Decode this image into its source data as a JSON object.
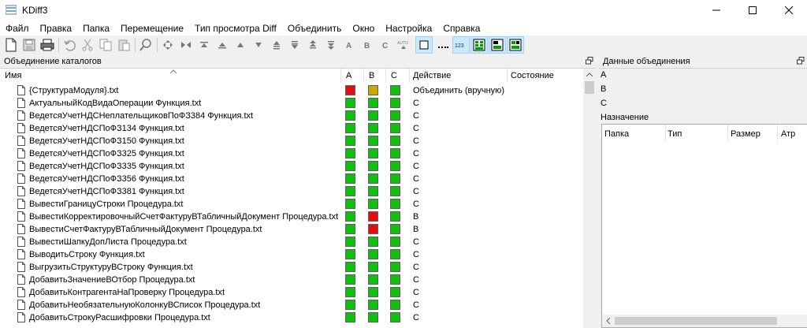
{
  "window": {
    "title": "KDiff3"
  },
  "menu": [
    "Файл",
    "Правка",
    "Папка",
    "Перемещение",
    "Тип просмотра Diff",
    "Объединить",
    "Окно",
    "Настройка",
    "Справка"
  ],
  "left_panel": {
    "title": "Объединение каталогов",
    "columns": {
      "name": "Имя",
      "a": "A",
      "b": "B",
      "c": "C",
      "action": "Действие",
      "state": "Состояние"
    },
    "rows": [
      {
        "name": "{СтруктураМодуля}.txt",
        "a": "red",
        "b": "yellow",
        "c": "green",
        "action": "Объединить (вручную)"
      },
      {
        "name": "АктуальныйКодВидаОперации Функция.txt",
        "a": "green",
        "b": "green",
        "c": "green",
        "action": "C"
      },
      {
        "name": "ВедетсяУчетНДСНеплательщиковПоФЗ384 Функция.txt",
        "a": "green",
        "b": "green",
        "c": "green",
        "action": "C"
      },
      {
        "name": "ВедетсяУчетНДСПоФЗ134 Функция.txt",
        "a": "green",
        "b": "green",
        "c": "green",
        "action": "C"
      },
      {
        "name": "ВедетсяУчетНДСПоФЗ150 Функция.txt",
        "a": "green",
        "b": "green",
        "c": "green",
        "action": "C"
      },
      {
        "name": "ВедетсяУчетНДСПоФЗ325 Функция.txt",
        "a": "green",
        "b": "green",
        "c": "green",
        "action": "C"
      },
      {
        "name": "ВедетсяУчетНДСПоФЗ335 Функция.txt",
        "a": "green",
        "b": "green",
        "c": "green",
        "action": "C"
      },
      {
        "name": "ВедетсяУчетНДСПоФЗ356 Функция.txt",
        "a": "green",
        "b": "green",
        "c": "green",
        "action": "C"
      },
      {
        "name": "ВедетсяУчетНДСПоФЗ381 Функция.txt",
        "a": "green",
        "b": "green",
        "c": "green",
        "action": "C"
      },
      {
        "name": "ВывестиГраницуСтроки Процедура.txt",
        "a": "green",
        "b": "green",
        "c": "green",
        "action": "C"
      },
      {
        "name": "ВывестиКорректировочныйСчетФактуруВТабличныйДокумент Процедура.txt",
        "a": "green",
        "b": "red",
        "c": "green",
        "action": "B"
      },
      {
        "name": "ВывестиСчетФактуруВТабличныйДокумент Процедура.txt",
        "a": "green",
        "b": "red",
        "c": "green",
        "action": "B"
      },
      {
        "name": "ВывестиШапкуДопЛиста Процедура.txt",
        "a": "green",
        "b": "green",
        "c": "green",
        "action": "C"
      },
      {
        "name": "ВыводитьСтроку Функция.txt",
        "a": "green",
        "b": "green",
        "c": "green",
        "action": "C"
      },
      {
        "name": "ВыгрузитьСтруктуруВСтроку Функция.txt",
        "a": "green",
        "b": "green",
        "c": "green",
        "action": "C"
      },
      {
        "name": "ДобавитьЗначениеВОтбор Процедура.txt",
        "a": "green",
        "b": "green",
        "c": "green",
        "action": "C"
      },
      {
        "name": "ДобавитьКонтрагентаНаПроверку Процедура.txt",
        "a": "green",
        "b": "green",
        "c": "green",
        "action": "C"
      },
      {
        "name": "ДобавитьНеобязательнуюКолонкуВСписок Процедура.txt",
        "a": "green",
        "b": "green",
        "c": "green",
        "action": "C"
      },
      {
        "name": "ДобавитьСтрокуРасшифровки Процедура.txt",
        "a": "green",
        "b": "green",
        "c": "green",
        "action": "C"
      }
    ]
  },
  "right_panel": {
    "title": "Данные объединения",
    "labels": {
      "a": "A",
      "b": "B",
      "c": "C",
      "dest": "Назначение"
    },
    "columns": [
      "Папка",
      "Тип",
      "Размер",
      "Атр"
    ]
  },
  "colors": {
    "red": "#e01010",
    "green": "#10c010",
    "yellow": "#c8a800",
    "accent": "#cce8ff"
  },
  "toolbar_icons": [
    "new-icon",
    "save-icon",
    "print-icon",
    "undo-icon",
    "cut-icon",
    "copy-icon",
    "paste-icon",
    "find-icon",
    "goto-current-icon",
    "goto-top-icon",
    "goto-bottom-icon",
    "prev-delta-icon",
    "next-delta-icon",
    "prev-conflict-icon",
    "next-conflict-icon",
    "prev-unsolved-icon",
    "next-unsolved-icon",
    "choose-a-icon",
    "choose-b-icon",
    "choose-c-icon",
    "auto-advance-icon",
    "show-whitespace-icon",
    "show-whitespace-chars-icon",
    "show-line-numbers-icon",
    "toggle-window-a-icon",
    "toggle-window-b-icon",
    "toggle-window-c-icon"
  ]
}
